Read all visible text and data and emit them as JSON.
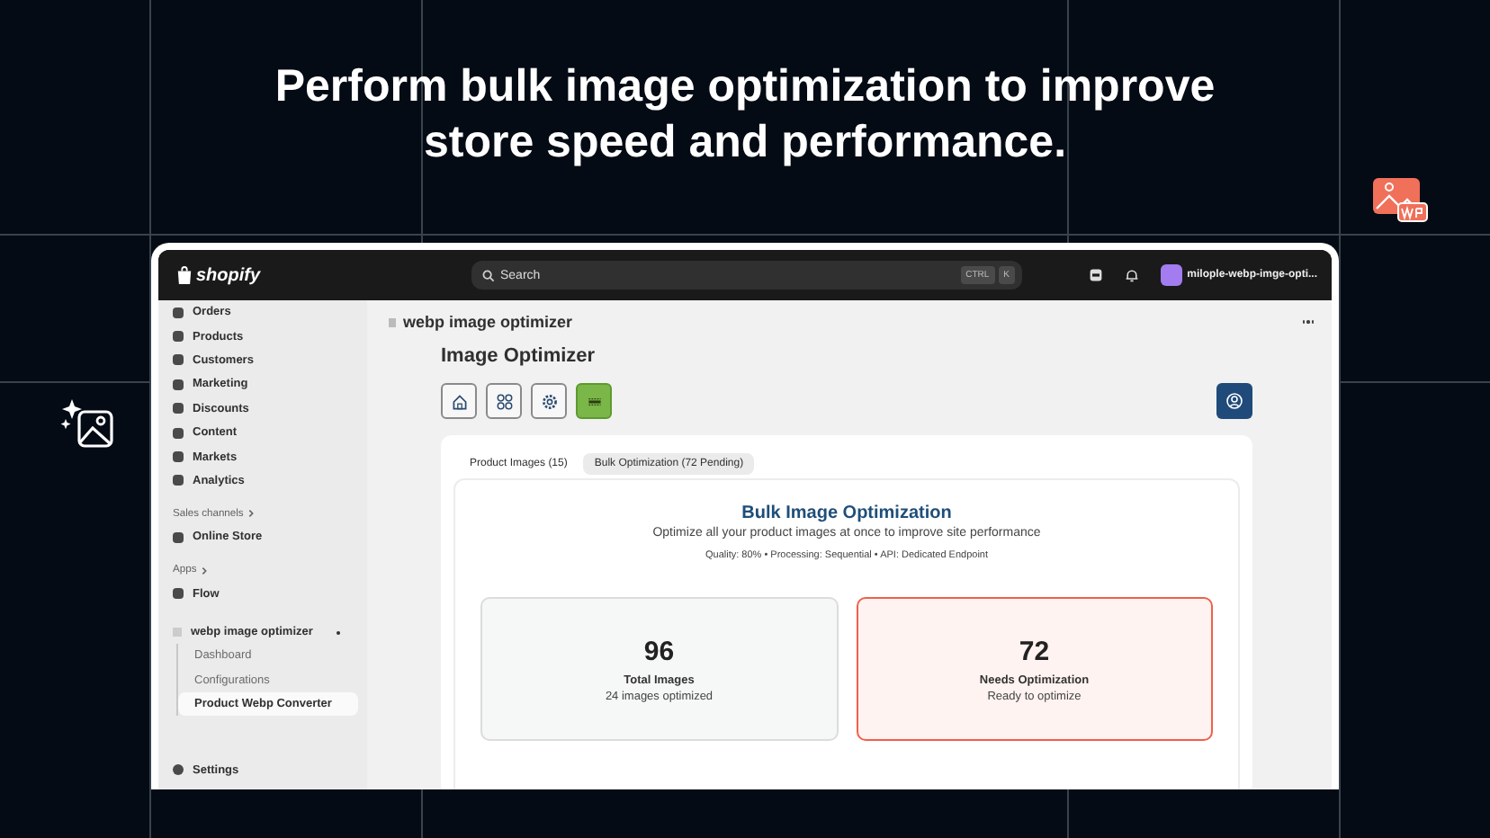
{
  "headline": "Perform bulk image optimization to improve store speed and performance.",
  "topbar": {
    "logo": "shopify",
    "search": {
      "placeholder": "Search"
    },
    "shortcut": [
      "CTRL",
      "K"
    ],
    "store": "milople-webp-imge-opti..."
  },
  "sidebar": {
    "items": [
      {
        "label": "Orders",
        "selected": false
      },
      {
        "label": "Products",
        "selected": false
      },
      {
        "label": "Customers",
        "selected": false
      },
      {
        "label": "Marketing",
        "selected": false
      },
      {
        "label": "Discounts",
        "selected": false
      },
      {
        "label": "Content",
        "selected": false
      },
      {
        "label": "Markets",
        "selected": false
      },
      {
        "label": "Analytics",
        "selected": false
      }
    ],
    "sections": [
      {
        "heading": "Sales channels",
        "items": [
          {
            "label": "Online Store",
            "selected": false
          }
        ]
      },
      {
        "heading": "Apps",
        "items": [
          {
            "label": "Flow",
            "selected": false
          }
        ]
      }
    ],
    "app": {
      "label": "webp image optimizer",
      "children": [
        {
          "label": "Dashboard",
          "selected": false
        },
        {
          "label": "Configurations",
          "selected": false
        },
        {
          "label": "Product Webp Converter",
          "selected": true
        }
      ]
    },
    "footer": "Settings"
  },
  "page": {
    "app_title": "webp image optimizer",
    "heading": "Image Optimizer",
    "toolbar": [
      {
        "kind": "home",
        "selected": false
      },
      {
        "kind": "grid",
        "selected": false
      },
      {
        "kind": "gear",
        "selected": false
      },
      {
        "kind": "webp",
        "selected": true
      }
    ],
    "tabs": [
      {
        "label": "Product Images (15)",
        "selected": false
      },
      {
        "label": "Bulk Optimization (72 Pending)",
        "selected": true
      }
    ],
    "panel": {
      "title": "Bulk Image Optimization",
      "subtitle": "Optimize all your product images at once to improve site performance",
      "meta": "Quality: 80% • Processing: Sequential • API: Dedicated Endpoint",
      "stats": [
        {
          "kind": "neutral",
          "value": "96",
          "label": "Total Images",
          "note": "24 images optimized"
        },
        {
          "kind": "alert",
          "value": "72",
          "label": "Needs Optimization",
          "note": "Ready to optimize"
        }
      ]
    }
  }
}
